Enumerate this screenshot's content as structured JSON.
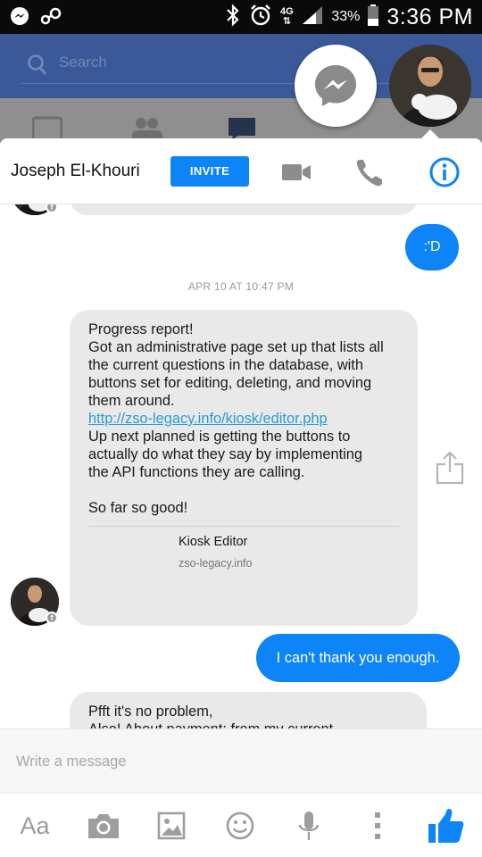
{
  "status_bar": {
    "time": "3:36 PM",
    "battery": "33%",
    "network": "4G"
  },
  "background_app": {
    "search_placeholder": "Search"
  },
  "chat_header": {
    "contact_name": "Joseph El-Khouri",
    "invite_label": "INVITE"
  },
  "messages": {
    "sent_emoticon": ":'D",
    "timestamp": "APR 10 AT 10:47 PM",
    "received_main": {
      "line1": "Progress report!",
      "line2": "Got an administrative page set up that lists all",
      "line3": "the current questions in the database, with",
      "line4": "buttons set for editing, deleting, and moving",
      "line5": "them around.",
      "link": "http://zso-legacy.info/kiosk/editor.php",
      "line6": "Up next planned is getting the buttons to",
      "line7": "actually do what they say by implementing",
      "line8": "the API functions they are calling.",
      "line9": "So far so good!"
    },
    "link_preview": {
      "title": "Kiosk Editor",
      "domain": "zso-legacy.info"
    },
    "sent_thanks": "I can't thank you enough.",
    "received_second": {
      "line1": "Pfft it's no problem,",
      "line2": "Also! About payment: from my current"
    }
  },
  "composer": {
    "placeholder": "Write a message",
    "aa_label": "Aa"
  },
  "colors": {
    "messenger_blue": "#0d84f7",
    "facebook_blue": "#3b5998",
    "received_bubble": "#e9e9e9",
    "link": "#2a9bd4"
  },
  "icons": [
    "messenger-icon",
    "video-call-icon",
    "phone-icon",
    "info-icon",
    "share-icon",
    "camera-icon",
    "gallery-icon",
    "emoji-icon",
    "microphone-icon",
    "more-icon",
    "like-icon"
  ]
}
